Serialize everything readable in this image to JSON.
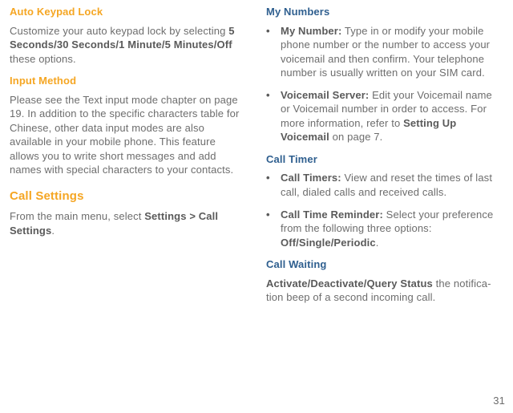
{
  "pageNumber": "31",
  "left": {
    "h1": "Auto Keypad Lock",
    "p1a": "Customize your auto keypad lock by selecting ",
    "p1b": "5 Seconds/30 Seconds/1 Minute/5 Minutes/Off",
    "p1c": " these options.",
    "h2": "Input Method",
    "p2": "Please see the Text input mode chapter on page 19. In addition to the specific characters table for Chinese, other data input modes are also available in your mobile phone. This feature allows you to write short messages and add names with special characters to your contacts.",
    "h3": "Call Settings",
    "p3a": "From the main menu, select ",
    "p3b": "Settings > Call Settings",
    "p3c": "."
  },
  "right": {
    "h1": "My Numbers",
    "li1a": "My Number:",
    "li1b": " Type in or modify your mobile phone number or the number to access your voicemail and then confirm. Your telephone number is usually written on your SIM card.",
    "li2a": "Voicemail Server:",
    "li2b": " Edit your Voicemail name or Voicemail number in order to access. For more information, refer to ",
    "li2c": "Setting Up Voicemail",
    "li2d": " on page 7.",
    "h2": "Call Timer",
    "li3a": "Call Timers:",
    "li3b": " View and reset the times of last call, dialed calls and received calls.",
    "li4a": "Call Time Reminder:",
    "li4b": " Select your preference from the following three options: ",
    "li4c": "Off/Single/Periodic",
    "li4d": ".",
    "h3": "Call Waiting",
    "p3a": "Activate/Deactivate/Query Status",
    "p3b": " the notifica­tion beep of a second incoming call."
  }
}
